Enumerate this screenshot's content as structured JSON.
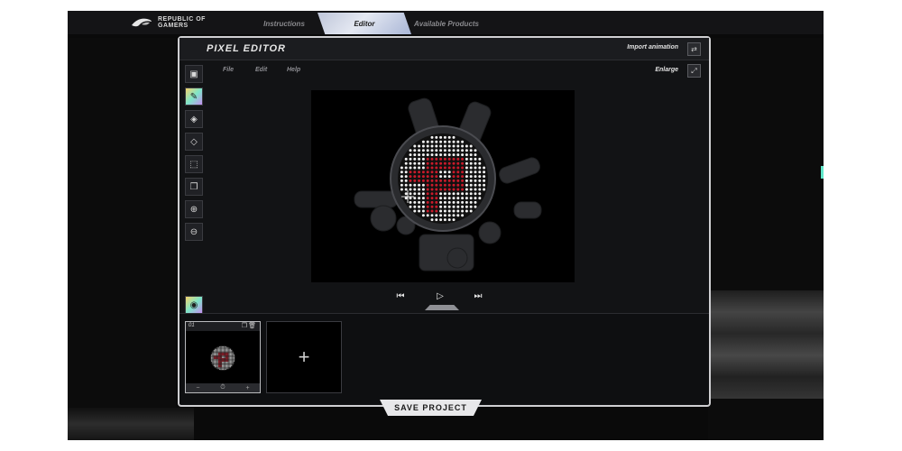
{
  "header": {
    "logo_line1": "REPUBLIC OF",
    "logo_line2": "GAMERS",
    "tabs": [
      {
        "label": "Instructions"
      },
      {
        "label": "Editor"
      },
      {
        "label": "Available Products"
      }
    ]
  },
  "editor": {
    "title": "PIXEL EDITOR",
    "import_label": "Import animation",
    "enlarge_label": "Enlarge",
    "menu": [
      {
        "label": "File"
      },
      {
        "label": "Edit"
      },
      {
        "label": "Help"
      }
    ],
    "tools": [
      {
        "icon": "image-icon"
      },
      {
        "icon": "color-brush-icon"
      },
      {
        "icon": "fill-bucket-icon"
      },
      {
        "icon": "eraser-icon"
      },
      {
        "icon": "selection-icon"
      },
      {
        "icon": "copy-icon"
      },
      {
        "icon": "zoom-in-icon"
      },
      {
        "icon": "zoom-out-icon"
      },
      {
        "icon": "preview-eye-icon"
      }
    ],
    "colors": {
      "accent_pixel": "#c81a2a",
      "white_pixel": "#f2f2f2"
    }
  },
  "timeline": {
    "frame_number": "01",
    "add_symbol": "+"
  },
  "footer": {
    "save_label": "SAVE PROJECT"
  }
}
